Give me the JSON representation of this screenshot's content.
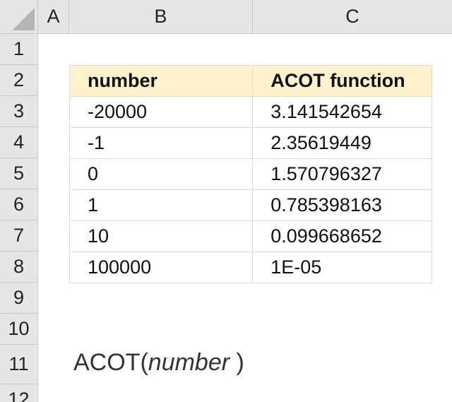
{
  "columns": {
    "a": "A",
    "b": "B",
    "c": "C"
  },
  "rows": [
    "1",
    "2",
    "3",
    "4",
    "5",
    "6",
    "7",
    "8",
    "9",
    "10",
    "11",
    "12"
  ],
  "table": {
    "headers": [
      "number",
      "ACOT function"
    ],
    "rows": [
      [
        "-20000",
        "3.141542654"
      ],
      [
        "-1",
        "2.35619449"
      ],
      [
        "0",
        "1.570796327"
      ],
      [
        "1",
        "0.785398163"
      ],
      [
        "10",
        "0.099668652"
      ],
      [
        "100000",
        "1E-05"
      ]
    ]
  },
  "formula": {
    "name": "ACOT(",
    "argument": "number",
    "close": " )"
  },
  "colors": {
    "header_fill": "#fff2cc",
    "grid_header": "#e6e6e6"
  }
}
